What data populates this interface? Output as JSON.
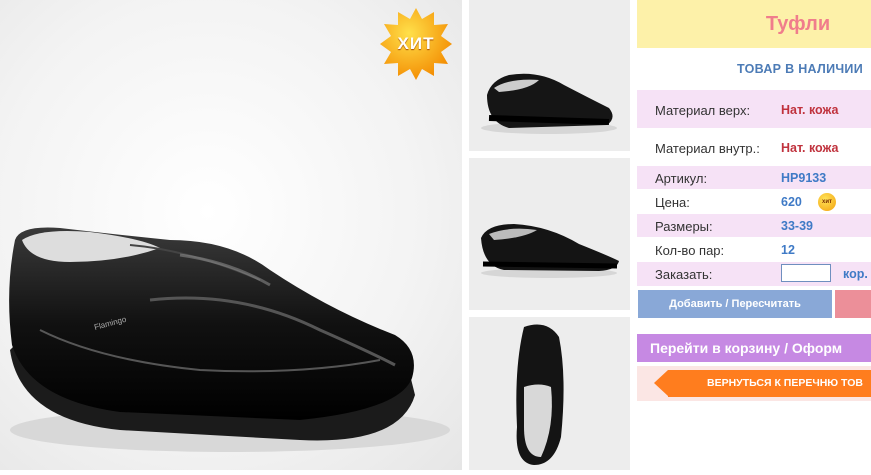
{
  "badge": {
    "hit_label": "ХИТ",
    "mini_hit_label": "хит"
  },
  "product": {
    "title": "Туфли",
    "stock_status": "ТОВАР В НАЛИЧИИ",
    "specs": [
      {
        "label": "Материал верх:",
        "value": "Нат. кожа"
      },
      {
        "label": "Материал внутр.:",
        "value": "Нат. кожа"
      },
      {
        "label": "Артикул:",
        "value": "HP9133"
      },
      {
        "label": "Цена:",
        "value": "620"
      },
      {
        "label": "Размеры:",
        "value": "33-39"
      },
      {
        "label": "Кол-во пар:",
        "value": "12"
      }
    ],
    "order": {
      "label": "Заказать:",
      "value": "",
      "unit": "кор."
    }
  },
  "actions": {
    "add_recalc": "Добавить / Пересчитать",
    "go_to_cart": "Перейти в корзину / Оформ",
    "back_to_list": "ВЕРНУТЬСЯ К ПЕРЕЧНЮ ТОВ"
  },
  "colors": {
    "accent_pink": "#f07d8c",
    "accent_blue": "#3f7ac6",
    "orange": "#ff7d1e",
    "purple": "#c689e3"
  }
}
